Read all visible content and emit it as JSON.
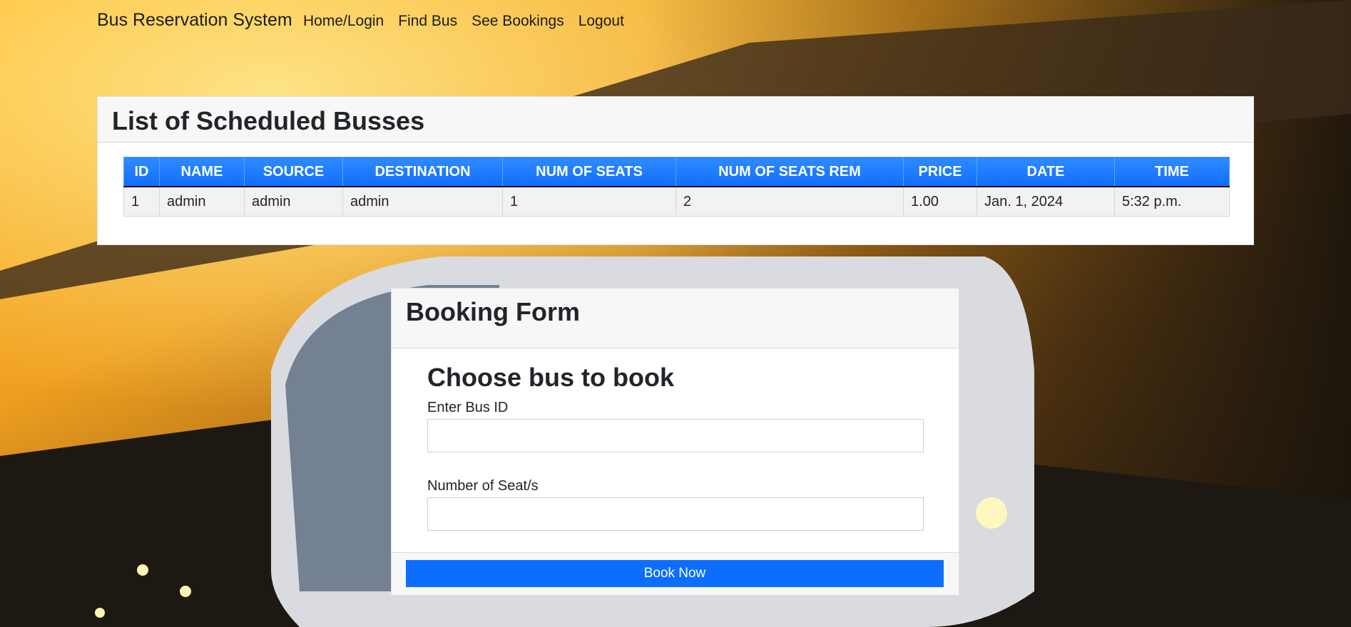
{
  "nav": {
    "brand": "Bus Reservation System",
    "links": [
      "Home/Login",
      "Find Bus",
      "See Bookings",
      "Logout"
    ]
  },
  "busses": {
    "title": "List of Scheduled Busses",
    "columns": [
      "ID",
      "NAME",
      "SOURCE",
      "DESTINATION",
      "NUM OF SEATS",
      "NUM OF SEATS REM",
      "PRICE",
      "DATE",
      "TIME"
    ],
    "rows": [
      [
        "1",
        "admin",
        "admin",
        "admin",
        "1",
        "2",
        "1.00",
        "Jan. 1, 2024",
        "5:32 p.m."
      ]
    ]
  },
  "booking": {
    "title": "Booking Form",
    "heading": "Choose bus to book",
    "bus_id_label": "Enter Bus ID",
    "bus_id_value": "",
    "seats_label": "Number of Seat/s",
    "seats_value": "",
    "submit_label": "Book Now"
  },
  "colors": {
    "primary": "#0d6efd",
    "header_bg": "#f7f7f7"
  }
}
